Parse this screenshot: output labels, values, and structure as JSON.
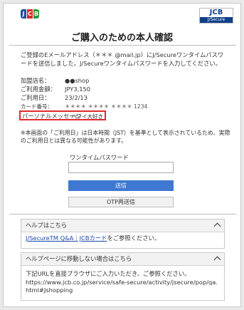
{
  "header": {
    "jcb_logo": {
      "letters": [
        "J",
        "C",
        "B"
      ],
      "colors": [
        "#1f4ea2",
        "#d62c2c",
        "#2c9a3c"
      ]
    },
    "secure_logo": {
      "top": "JCB",
      "bottom": "J/Secure"
    }
  },
  "page_title": "ご購入のための本人確認",
  "intro": "ご登録のEメールアドレス（＊＊＊ @mail.jp）にJ/Secureワンタイムパスワードを送信しました。J/Secureワンタイムパスワードを入力してください。",
  "purchase_info": [
    {
      "label": "加盟店名：",
      "value": "●●shop"
    },
    {
      "label": "ご利用金額：",
      "value": "JPY3,150"
    },
    {
      "label": "ご利用日：",
      "value": "23/2/13"
    },
    {
      "label": "カード番号：",
      "value": "＊＊＊＊ ＊＊＊＊ ＊＊＊＊ 1234"
    }
  ],
  "personal_message": {
    "label": "パーソナルメッセージ",
    "value": "ハワイ大好き"
  },
  "note": "※本画面の「ご利用日」は日本時間（JST）を基準として表示されているため、実際のご利用日とは異なる可能性があります。",
  "otp": {
    "label": "ワンタイムパスワード",
    "value": "",
    "placeholder": ""
  },
  "buttons": {
    "send": "送信",
    "resend": "OTP再送信"
  },
  "help": {
    "title": "ヘルプはこちら",
    "link_text": "J/SecureTM Q&A｜JCBカード",
    "suffix": "をご参照ください。"
  },
  "help_fallback": {
    "title": "ヘルプページに移動しない場合はこちら",
    "text": "下記URLを直接ブラウザにご入力いただき、ご参照ください。",
    "url": "https://www.jcb.co.jp/service/safe-secure/activity/jsecure/pop/qa.html#Jshopping"
  },
  "colors": {
    "accent_blue": "#3e78d1",
    "highlight_red": "#e02a2a",
    "link_blue": "#1a4aa8"
  }
}
